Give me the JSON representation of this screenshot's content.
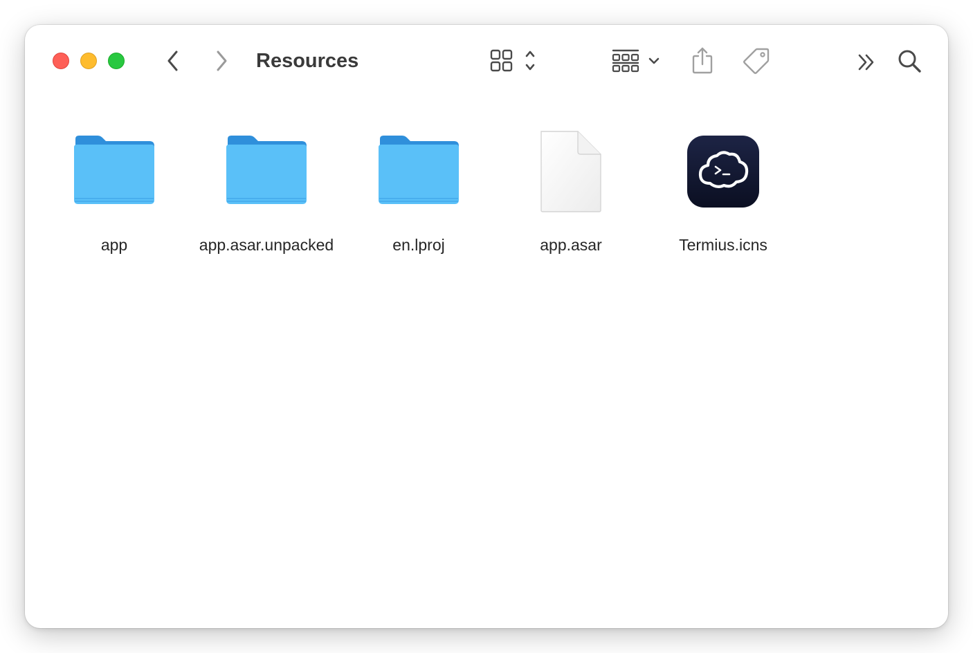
{
  "window": {
    "title": "Resources"
  },
  "toolbar": {
    "back_icon": "chevron-left-icon",
    "forward_icon": "chevron-right-icon",
    "view_mode_icon": "icon-grid-view-icon",
    "group_icon": "group-by-icon",
    "share_icon": "share-icon",
    "tag_icon": "tag-icon",
    "more_icon": "double-chevron-right-icon",
    "search_icon": "search-icon"
  },
  "files": [
    {
      "name": "app",
      "kind": "folder"
    },
    {
      "name": "app.asar.unpacked",
      "kind": "folder"
    },
    {
      "name": "en.lproj",
      "kind": "folder"
    },
    {
      "name": "app.asar",
      "kind": "document"
    },
    {
      "name": "Termius.icns",
      "kind": "app-icon"
    }
  ],
  "colors": {
    "folder_top": "#5ac0f8",
    "folder_back": "#2f8fdb",
    "close": "#fe5f57",
    "minimize": "#febc2e",
    "zoom": "#28c840",
    "termius_bg": "#141a33"
  }
}
